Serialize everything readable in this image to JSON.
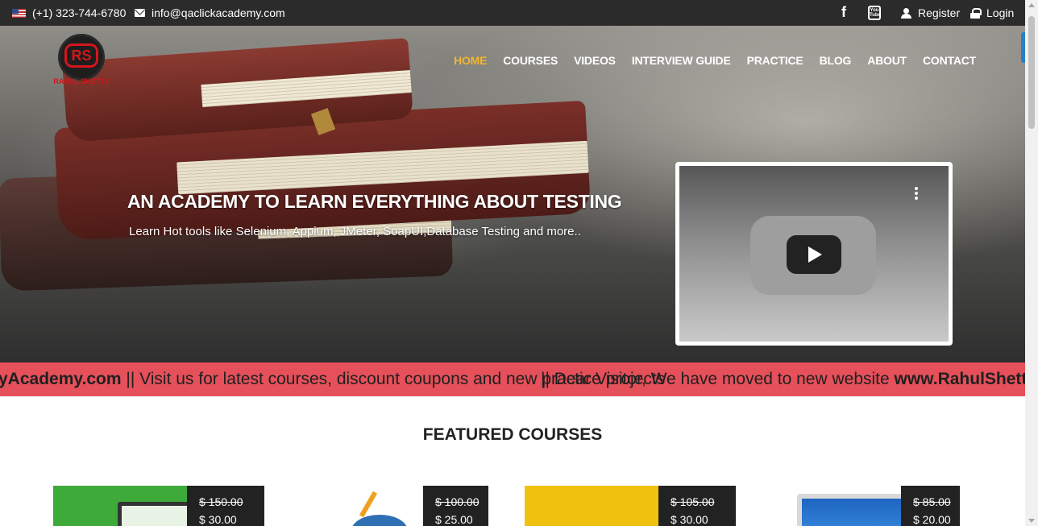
{
  "topbar": {
    "phone": "(+1) 323-744-6780",
    "email": "info@qaclickacademy.com",
    "facebook_glyph": "f",
    "youtube_glyph": "You Tube",
    "register_label": "Register",
    "login_label": "Login",
    "icons": [
      "us-flag-icon",
      "envelope-icon",
      "facebook-icon",
      "youtube-icon",
      "user-icon",
      "lock-icon"
    ]
  },
  "logo": {
    "monogram": "RS",
    "name": "RAHUL SHETTY"
  },
  "nav": {
    "items": [
      "HOME",
      "COURSES",
      "VIDEOS",
      "INTERVIEW GUIDE",
      "PRACTICE",
      "BLOG",
      "ABOUT",
      "CONTACT"
    ],
    "active": "HOME",
    "active_color": "#f2b632"
  },
  "hero": {
    "headline": "AN ACADEMY TO LEARN EVERYTHING ABOUT TESTING",
    "subline": "Learn Hot tools like Selenium, Appium, JMeter, SoapUI,Database Testing and more.."
  },
  "video": {
    "icons": [
      "more-vert-icon",
      "play-icon"
    ]
  },
  "marquee": {
    "part1_bold": "yAcademy.com",
    "part1_rest": " || Visit us for latest courses, discount coupons and new practice projects",
    "part2_rest": "|| Dear Visitor, We have moved to new website ",
    "part2_bold": "www.RahulShettyAca",
    "background": "#e5505a"
  },
  "featured": {
    "title": "FEATURED COURSES"
  },
  "courses": [
    {
      "old_price": "$ 150.00",
      "price": "$ 30.00"
    },
    {
      "old_price": "$ 100.00",
      "price": "$ 25.00"
    },
    {
      "old_price": "$ 105.00",
      "price": "$ 30.00"
    },
    {
      "old_price": "$ 85.00",
      "price": "$ 20.00"
    }
  ]
}
